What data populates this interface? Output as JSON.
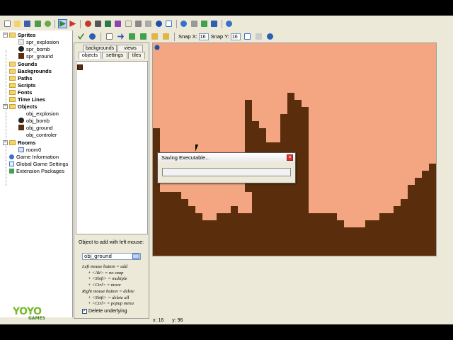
{
  "tree": {
    "sprites": "Sprites",
    "sprite_items": [
      "spr_explosion",
      "spr_bomb",
      "spr_ground"
    ],
    "sounds": "Sounds",
    "backgrounds": "Backgrounds",
    "paths": "Paths",
    "scripts": "Scripts",
    "fonts": "Fonts",
    "timelines": "Time Lines",
    "objects": "Objects",
    "object_items": [
      "obj_explosion",
      "obj_bomb",
      "obj_ground",
      "obj_controler"
    ],
    "rooms": "Rooms",
    "room_items": [
      "room0"
    ],
    "game_info": "Game Information",
    "global_settings": "Global Game Settings",
    "extensions": "Extension Packages"
  },
  "logo": {
    "yoyo": "YOYO",
    "games": "GAMES"
  },
  "room_toolbar": {
    "snap_x_label": "Snap X:",
    "snap_x": "16",
    "snap_y_label": "Snap Y:",
    "snap_y": "16"
  },
  "room_panel": {
    "tabs_top": [
      "backgrounds",
      "views"
    ],
    "tabs_bottom": [
      "objects",
      "settings",
      "tiles"
    ],
    "add_label": "Object to add with left mouse:",
    "selected_object": "obj_ground",
    "help": [
      "Left mouse button = add",
      "+ <Alt> = no snap",
      "+ <Shift> = multiple",
      "+ <Ctrl> = move",
      "Right mouse button = delete",
      "+ <Shift> = delete all",
      "+ <Ctrl> = popup menu"
    ],
    "delete_underlying": "Delete underlying"
  },
  "status": {
    "x": "x: 16",
    "y": "y: 96"
  },
  "dialog": {
    "title": "Saving Executable...",
    "progress": 0
  },
  "colors": {
    "sky": "#f4a582",
    "ground": "#5a2d0c"
  }
}
